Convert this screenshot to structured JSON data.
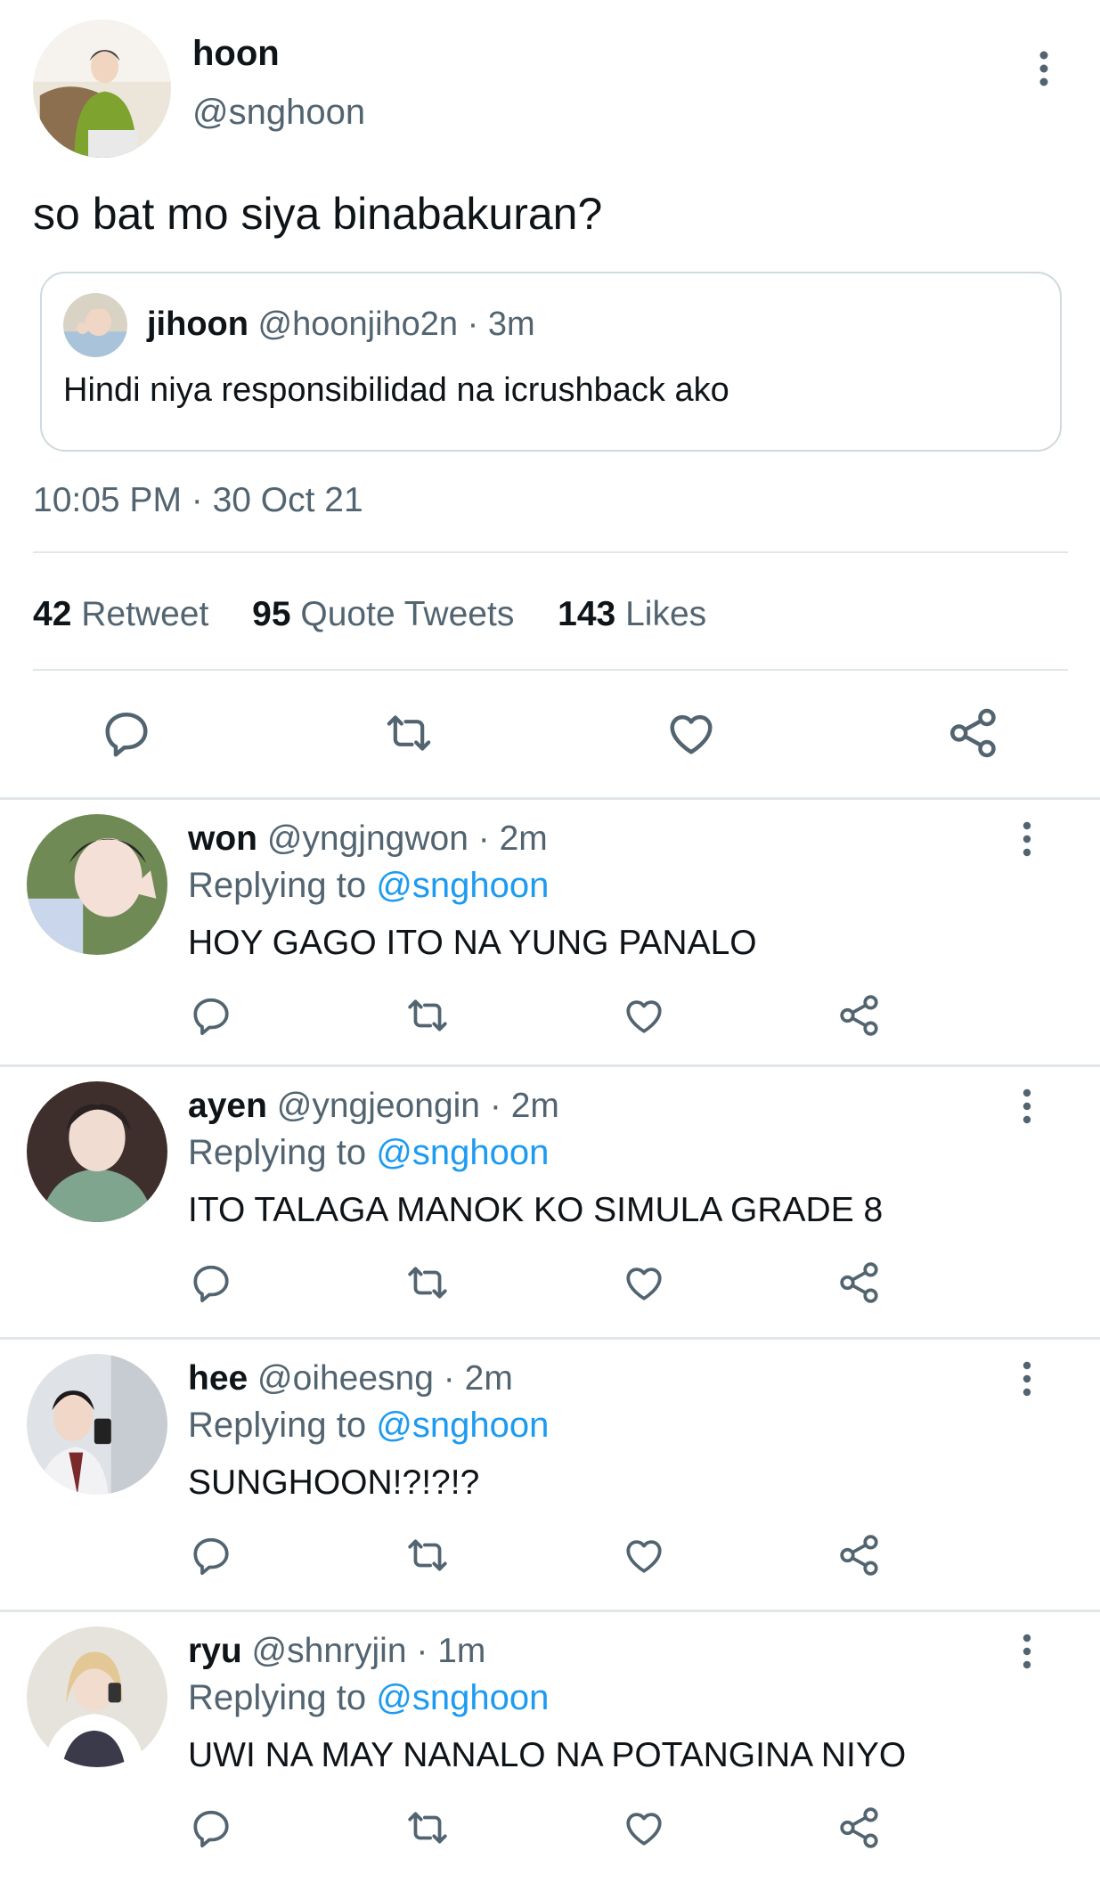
{
  "tweet": {
    "name": "hoon",
    "handle": "@snghoon",
    "text": "so bat mo siya binabakuran?",
    "quote": {
      "name": "jihoon",
      "handle": "@hoonjiho2n",
      "separator": "·",
      "time": "3m",
      "text": "Hindi niya responsibilidad na icrushback ako"
    },
    "timestamp": "10:05 PM · 30 Oct 21",
    "stats": {
      "retweets": "42",
      "retweets_label": "Retweet",
      "quotes": "95",
      "quotes_label": "Quote Tweets",
      "likes": "143",
      "likes_label": "Likes"
    },
    "actions": [
      "reply-icon",
      "retweet-icon",
      "like-icon",
      "share-icon"
    ]
  },
  "replies": [
    {
      "name": "won",
      "handle": "@yngjngwon",
      "separator": "·",
      "time": "2m",
      "replying_prefix": "Replying to",
      "replying_to": "@snghoon",
      "text": "HOY GAGO ITO NA YUNG PANALO"
    },
    {
      "name": "ayen",
      "handle": "@yngjeongin",
      "separator": "·",
      "time": "2m",
      "replying_prefix": "Replying to",
      "replying_to": "@snghoon",
      "text": "ITO TALAGA MANOK KO SIMULA GRADE 8"
    },
    {
      "name": "hee",
      "handle": "@oiheesng",
      "separator": "·",
      "time": "2m",
      "replying_prefix": "Replying to",
      "replying_to": "@snghoon",
      "text": "SUNGHOON!?!?!?"
    },
    {
      "name": "ryu",
      "handle": "@shnryjin",
      "separator": "·",
      "time": "1m",
      "replying_prefix": "Replying to",
      "replying_to": "@snghoon",
      "text": "UWI NA MAY NANALO NA POTANGINA NIYO"
    }
  ],
  "colors": {
    "text": "#0f1419",
    "secondary": "#536471",
    "link": "#1d9bf0",
    "divider": "#e1e6ea"
  }
}
